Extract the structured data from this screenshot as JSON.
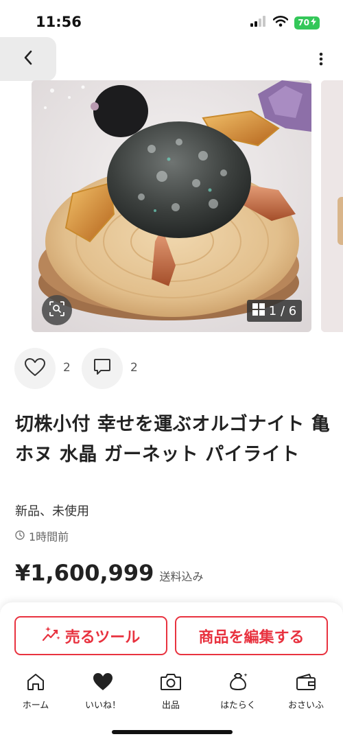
{
  "status": {
    "time": "11:56",
    "battery": "70"
  },
  "gallery": {
    "counter": "1 / 6"
  },
  "likes": {
    "count": "2"
  },
  "comments": {
    "count": "2"
  },
  "product": {
    "title": "切株小付 幸せを運ぶオルゴナイト 亀 ホヌ 水晶 ガーネット パイライト",
    "condition": "新品、未使用",
    "posted": "1時間前",
    "price": "¥1,600,999",
    "shipping": "送料込み"
  },
  "actions": {
    "sell_tools": "売るツール",
    "edit": "商品を編集する"
  },
  "tabbar": {
    "home": "ホーム",
    "likes": "いいね！",
    "sell": "出品",
    "work": "はたらく",
    "wallet": "おさいふ"
  },
  "colors": {
    "accent": "#e8323f",
    "battery": "#34c759"
  }
}
